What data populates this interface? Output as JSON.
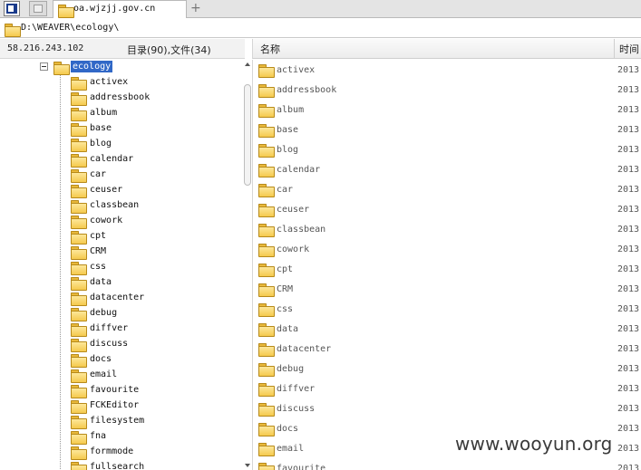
{
  "tab": {
    "title": "oa.wjzjj.gov.cn",
    "new_tab_label": "+"
  },
  "path": "D:\\WEAVER\\ecology\\",
  "info": {
    "ip": "58.216.243.102",
    "counts": "目录(90),文件(34)"
  },
  "columns": {
    "name": "名称",
    "time": "时间"
  },
  "tree": {
    "root": "ecology",
    "items": [
      "activex",
      "addressbook",
      "album",
      "base",
      "blog",
      "calendar",
      "car",
      "ceuser",
      "classbean",
      "cowork",
      "cpt",
      "CRM",
      "css",
      "data",
      "datacenter",
      "debug",
      "diffver",
      "discuss",
      "docs",
      "email",
      "favourite",
      "FCKEditor",
      "filesystem",
      "fna",
      "formmode",
      "fullsearch"
    ]
  },
  "files": [
    {
      "name": "activex",
      "time": "2013"
    },
    {
      "name": "addressbook",
      "time": "2013"
    },
    {
      "name": "album",
      "time": "2013"
    },
    {
      "name": "base",
      "time": "2013"
    },
    {
      "name": "blog",
      "time": "2013"
    },
    {
      "name": "calendar",
      "time": "2013"
    },
    {
      "name": "car",
      "time": "2013"
    },
    {
      "name": "ceuser",
      "time": "2013"
    },
    {
      "name": "classbean",
      "time": "2013"
    },
    {
      "name": "cowork",
      "time": "2013"
    },
    {
      "name": "cpt",
      "time": "2013"
    },
    {
      "name": "CRM",
      "time": "2013"
    },
    {
      "name": "css",
      "time": "2013"
    },
    {
      "name": "data",
      "time": "2013"
    },
    {
      "name": "datacenter",
      "time": "2013"
    },
    {
      "name": "debug",
      "time": "2013"
    },
    {
      "name": "diffver",
      "time": "2013"
    },
    {
      "name": "discuss",
      "time": "2013"
    },
    {
      "name": "docs",
      "time": "2013"
    },
    {
      "name": "email",
      "time": "2013"
    },
    {
      "name": "favourite",
      "time": "2013"
    }
  ],
  "watermark": "www.wooyun.org",
  "colors": {
    "selection": "#3168c7",
    "folder": "#f5c94d"
  }
}
